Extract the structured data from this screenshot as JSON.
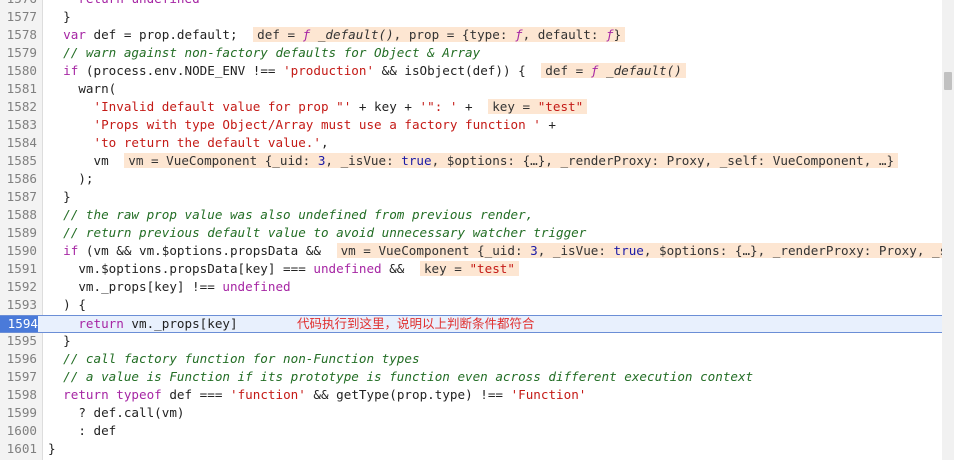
{
  "editor": {
    "lines": [
      {
        "n": "1576",
        "html": "    <span class=\"kw\">return</span> <span class=\"kw\">undefined</span>"
      },
      {
        "n": "1577",
        "html": "  }"
      },
      {
        "n": "1578",
        "html": "  <span class=\"kw\">var</span> def = prop.default; <span class=\"inl\">def = <span class=\"kwi\">ƒ</span> <i>_default()</i>, prop = {type: <span class=\"kwi\">ƒ</span>, default: <span class=\"kwi\">ƒ</span>}</span>"
      },
      {
        "n": "1579",
        "html": "  <span class=\"cm\">// warn against non-factory defaults for Object &amp; Array</span>"
      },
      {
        "n": "1580",
        "html": "  <span class=\"kw\">if</span> (process.env.NODE_ENV !== <span class=\"str\">'production'</span> &amp;&amp; isObject(def)) { <span class=\"inl\">def = <span class=\"kwi\">ƒ</span> <i>_default()</i></span>"
      },
      {
        "n": "1581",
        "html": "    warn("
      },
      {
        "n": "1582",
        "html": "      <span class=\"str\">'Invalid default value for prop \"'</span> + key + <span class=\"str\">'\": '</span> + <span class=\"inl\">key = <span class=\"s\">\"test\"</span></span>"
      },
      {
        "n": "1583",
        "html": "      <span class=\"str\">'Props with type Object/Array must use a factory function '</span> +"
      },
      {
        "n": "1584",
        "html": "      <span class=\"str\">'to return the default value.'</span>,"
      },
      {
        "n": "1585",
        "html": "      vm <span class=\"inl\">vm = VueComponent {_uid: <span class=\"b\">3</span>, _isVue: <span class=\"b\">true</span>, $options: {…}, _renderProxy: Proxy, _self: VueComponent, …}</span>"
      },
      {
        "n": "1586",
        "html": "    );"
      },
      {
        "n": "1587",
        "html": "  }"
      },
      {
        "n": "1588",
        "html": "  <span class=\"cm\">// the raw prop value was also undefined from previous render,</span>"
      },
      {
        "n": "1589",
        "html": "  <span class=\"cm\">// return previous default value to avoid unnecessary watcher trigger</span>"
      },
      {
        "n": "1590",
        "html": "  <span class=\"kw\">if</span> (vm &amp;&amp; vm.$options.propsData &amp;&amp; <span class=\"inl\">vm = VueComponent {_uid: <span class=\"b\">3</span>, _isVue: <span class=\"b\">true</span>, $options: {…}, _renderProxy: Proxy, _self: …}</span>"
      },
      {
        "n": "1591",
        "html": "    vm.$options.propsData[key] === <span class=\"kw\">undefined</span> &amp;&amp; <span class=\"inl\">key = <span class=\"s\">\"test\"</span></span>"
      },
      {
        "n": "1592",
        "html": "    vm._props[key] !== <span class=\"kw\">undefined</span>"
      },
      {
        "n": "1593",
        "html": "  ) {"
      },
      {
        "n": "1594",
        "html": "    <span class=\"kw\">return</span> vm._props[key]",
        "current": true,
        "note": "代码执行到这里，说明以上判断条件都符合"
      },
      {
        "n": "1595",
        "html": "  }"
      },
      {
        "n": "1596",
        "html": "  <span class=\"cm\">// call factory function for non-Function types</span>"
      },
      {
        "n": "1597",
        "html": "  <span class=\"cm\">// a value is Function if its prototype is function even across different execution context</span>"
      },
      {
        "n": "1598",
        "html": "  <span class=\"kw\">return</span> <span class=\"kw\">typeof</span> def === <span class=\"str\">'function'</span> &amp;&amp; getType(prop.type) !== <span class=\"str\">'Function'</span>"
      },
      {
        "n": "1599",
        "html": "    ? def.call(vm)"
      },
      {
        "n": "1600",
        "html": "    : def"
      },
      {
        "n": "1601",
        "html": "}"
      }
    ]
  },
  "colors": {
    "current_line": "#e8f0fd",
    "gutter_marker": "#4a7ad9",
    "note": "#e03030",
    "inline_value_bg": "#fde6d2"
  }
}
